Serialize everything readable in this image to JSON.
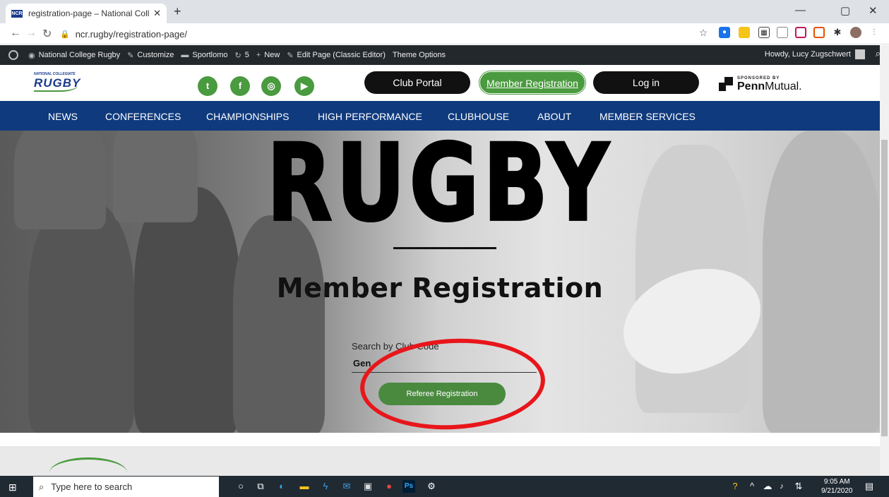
{
  "browser": {
    "tab_title": "registration-page – National Coll",
    "tab_favicon_text": "NCR",
    "url": "ncr.rugby/registration-page/"
  },
  "wp_admin_bar": {
    "site_name": "National College Rugby",
    "customize": "Customize",
    "sportlomo": "Sportlomo",
    "updates_count": "5",
    "new": "New",
    "edit_page": "Edit Page (Classic Editor)",
    "theme_options": "Theme Options",
    "howdy": "Howdy, Lucy Zugschwert"
  },
  "site_header": {
    "logo_small": "NATIONAL COLLEGIATE",
    "logo_big": "RUGBY",
    "buttons": {
      "club_portal": "Club Portal",
      "member_registration": "Member Registration",
      "log_in": "Log in"
    },
    "sponsor_small": "SPONSORED BY",
    "sponsor_name_bold": "Penn",
    "sponsor_name_light": "Mutual."
  },
  "nav": [
    "NEWS",
    "CONFERENCES",
    "CHAMPIONSHIPS",
    "HIGH PERFORMANCE",
    "CLUBHOUSE",
    "ABOUT",
    "MEMBER SERVICES"
  ],
  "hero": {
    "title": "RUGBY",
    "subtitle": "Member Registration",
    "search_label": "Search by Club Code",
    "search_value": "Gen",
    "referee_button": "Referee Registration"
  },
  "taskbar": {
    "search_placeholder": "Type here to search",
    "time": "9:05 AM",
    "date": "9/21/2020"
  },
  "colors": {
    "brand_green": "#4a9a3f",
    "nav_blue": "#0f3a7d",
    "annotation_red": "#e8161b"
  }
}
